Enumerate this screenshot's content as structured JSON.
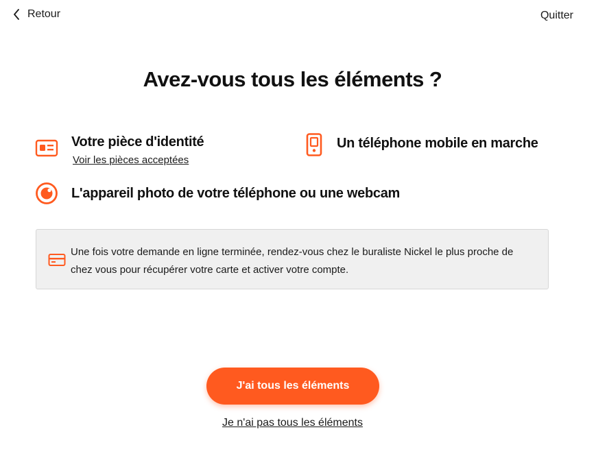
{
  "nav": {
    "back_label": "Retour",
    "quit_label": "Quitter"
  },
  "page": {
    "title": "Avez-vous tous les éléments ?"
  },
  "requirements": [
    {
      "icon": "id-card-icon",
      "label": "Votre pièce d'identité",
      "link": "Voir les pièces acceptées"
    },
    {
      "icon": "mobile-phone-icon",
      "label": "Un téléphone mobile en marche"
    },
    {
      "icon": "camera-lens-icon",
      "label": "L'appareil photo de votre téléphone ou une webcam"
    }
  ],
  "info": {
    "icon": "credit-card-icon",
    "message": "Une fois votre demande en ligne terminée, rendez-vous chez le buraliste Nickel le plus proche de chez vous pour récupérer votre carte et activer votre compte."
  },
  "actions": {
    "primary_label": "J'ai tous les éléments",
    "secondary_label": "Je n'ai pas tous les éléments"
  },
  "colors": {
    "accent": "#ff5a1f",
    "info_bg": "#f0f0f0",
    "text": "#1a1a1a"
  }
}
